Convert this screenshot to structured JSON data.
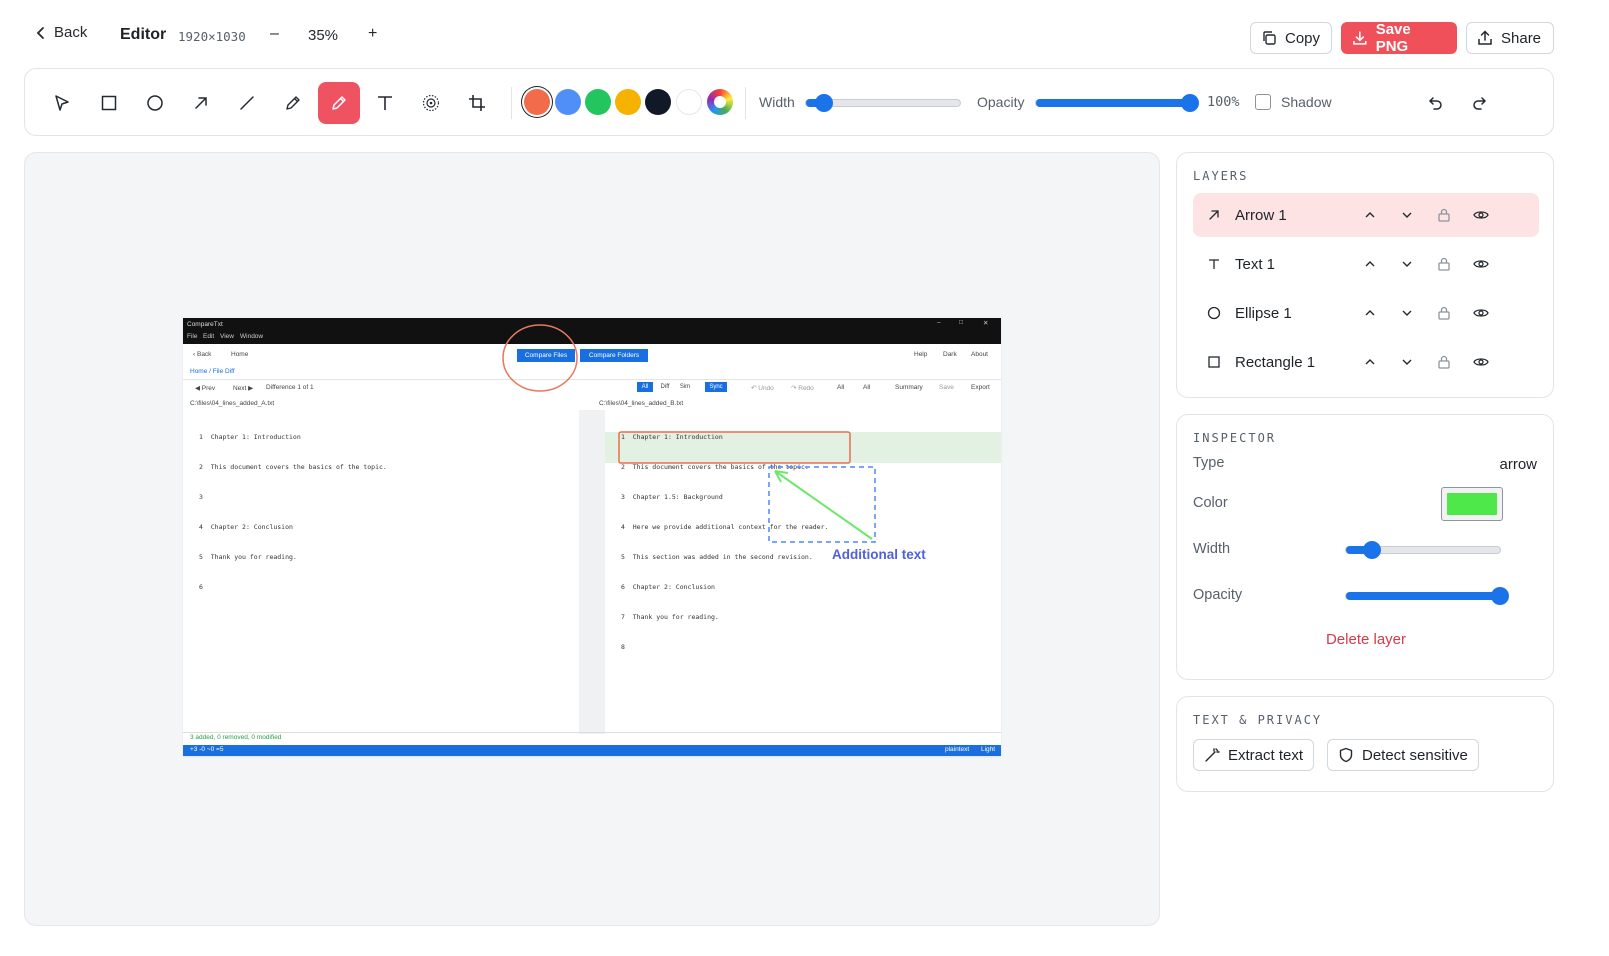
{
  "header": {
    "back_label": "Back",
    "title": "Editor",
    "dimensions": "1920×1030",
    "zoom_minus": "–",
    "zoom_level": "35%",
    "zoom_plus": "+",
    "copy_label": "Copy",
    "save_label": "Save PNG",
    "share_label": "Share"
  },
  "toolbar": {
    "tools": [
      "select-icon",
      "rectangle-icon",
      "ellipse-icon",
      "arrow-icon",
      "line-icon",
      "pencil-icon",
      "highlighter-icon",
      "text-icon",
      "blur-icon",
      "crop-icon"
    ],
    "active_tool": "highlighter-icon",
    "colors": [
      "#f26b4a",
      "#4f8ff7",
      "#22c55e",
      "#f5b300",
      "#111827",
      "#ffffff",
      "custom"
    ],
    "selected_color": "#f26b4a",
    "width_label": "Width",
    "width_value": 0.12,
    "opacity_label": "Opacity",
    "opacity_value": 1.0,
    "opacity_text": "100%",
    "shadow_label": "Shadow",
    "shadow_checked": false
  },
  "canvas": {
    "shot": {
      "app_title": "CompareTxt",
      "menu": [
        "File",
        "Edit",
        "View",
        "Window"
      ],
      "nav": [
        "Back",
        "Home"
      ],
      "compare_files": "Compare Files",
      "compare_folders": "Compare Folders",
      "right_links": [
        "Help",
        "Dark",
        "About"
      ],
      "breadcrumb": "Home / File Diff",
      "prev": "◀ Prev",
      "next": "Next ▶",
      "difference": "Difference 1 of 1",
      "modes": [
        "All",
        "Diff",
        "Sim",
        "Sync"
      ],
      "actions": [
        "↶ Undo",
        "↷ Redo",
        "All",
        "All",
        "Summary",
        "Save",
        "Export"
      ],
      "left_path": "C:\\files\\04_lines_added_A.txt",
      "right_path": "C:\\files\\04_lines_added_B.txt",
      "left_lines": [
        "1  Chapter 1: Introduction",
        "2  This document covers the basics of the topic.",
        "3",
        "4  Chapter 2: Conclusion",
        "5  Thank you for reading.",
        "6"
      ],
      "right_lines": [
        "1  Chapter 1: Introduction",
        "2  This document covers the basics of the topic.",
        "3  Chapter 1.5: Background",
        "4  Here we provide additional context for the reader.",
        "5  This section was added in the second revision.",
        "6  Chapter 2: Conclusion",
        "7  Thank you for reading.",
        "8"
      ],
      "summary": "3 added, 0 removed, 0 modified",
      "status_left": "+3 -0 ~0 =5",
      "status_right": [
        "plaintext",
        "Light"
      ]
    },
    "annotation_text": "Additional text",
    "annotation_arrow_color": "#6ee86a",
    "annotation_text_color": "#4f5fe0"
  },
  "layers": {
    "title": "LAYERS",
    "items": [
      {
        "icon": "arrow-icon",
        "label": "Arrow 1",
        "selected": true
      },
      {
        "icon": "text-icon",
        "label": "Text 1",
        "selected": false
      },
      {
        "icon": "ellipse-icon",
        "label": "Ellipse 1",
        "selected": false
      },
      {
        "icon": "rectangle-icon",
        "label": "Rectangle 1",
        "selected": false
      }
    ]
  },
  "inspector": {
    "title": "INSPECTOR",
    "type_label": "Type",
    "type_value": "arrow",
    "color_label": "Color",
    "color_value": "#4ee84a",
    "width_label": "Width",
    "width_value": 0.17,
    "opacity_label": "Opacity",
    "opacity_value": 1.0,
    "delete_label": "Delete layer"
  },
  "privacy": {
    "title": "TEXT & PRIVACY",
    "extract_label": "Extract text",
    "detect_label": "Detect sensitive"
  }
}
